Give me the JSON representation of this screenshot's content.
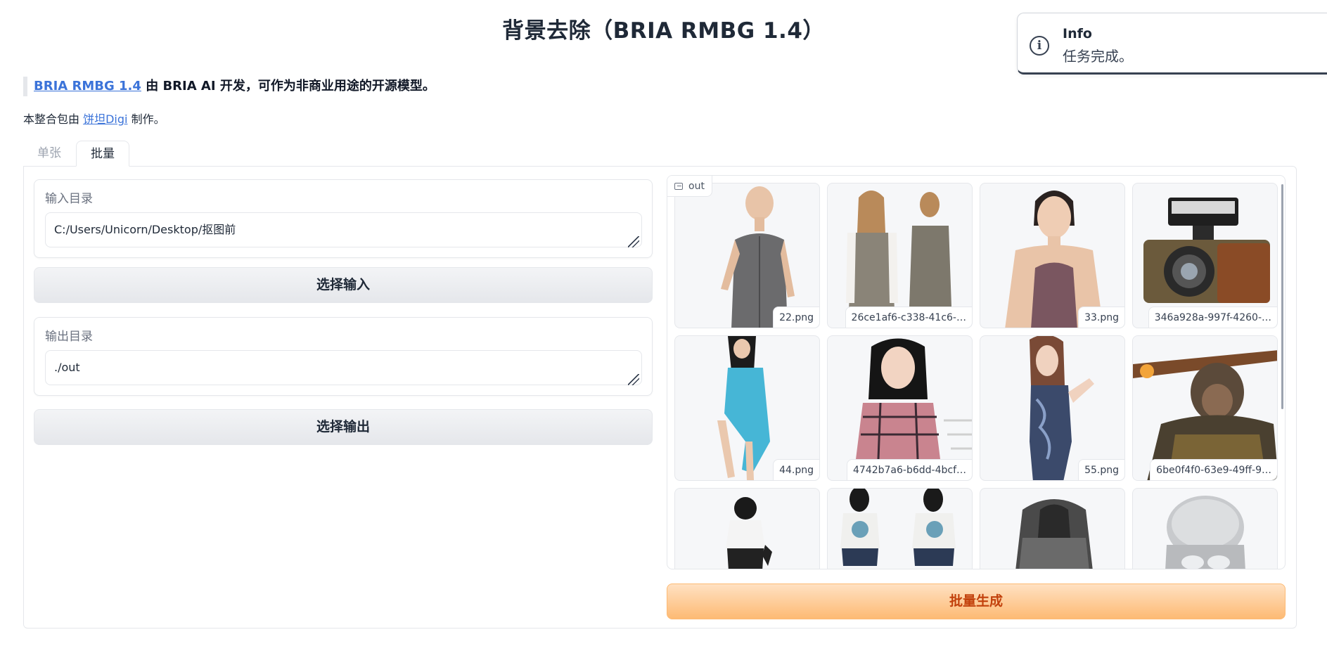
{
  "title": "背景去除（BRIA RMBG 1.4）",
  "toast": {
    "title": "Info",
    "message": "任务完成。",
    "icon": "info-icon"
  },
  "description": {
    "link_text": "BRIA RMBG 1.4",
    "text": "由 BRIA AI 开发，可作为非商业用途的开源模型。"
  },
  "credit": {
    "prefix": "本整合包由",
    "link_text": "饼坦Digi",
    "suffix": "制作。"
  },
  "tabs": [
    {
      "label": "单张",
      "active": false
    },
    {
      "label": "批量",
      "active": true
    }
  ],
  "input_dir": {
    "label": "输入目录",
    "value": "C:/Users/Unicorn/Desktop/抠图前"
  },
  "select_input_label": "选择输入",
  "output_dir": {
    "label": "输出目录",
    "value": "./out"
  },
  "select_output_label": "选择输出",
  "gallery": {
    "label": "out",
    "items": [
      {
        "caption": "22.png"
      },
      {
        "caption": "26ce1af6-c338-41c6-…"
      },
      {
        "caption": "33.png"
      },
      {
        "caption": "346a928a-997f-4260-…"
      },
      {
        "caption": "44.png"
      },
      {
        "caption": "4742b7a6-b6dd-4bcf…"
      },
      {
        "caption": "55.png"
      },
      {
        "caption": "6be0f4f0-63e9-49ff-9…"
      },
      {
        "caption": ""
      },
      {
        "caption": ""
      },
      {
        "caption": ""
      },
      {
        "caption": ""
      }
    ]
  },
  "generate_label": "批量生成",
  "colors": {
    "accent": "#fdba74",
    "accent_text": "#c2410c",
    "link": "#3b73d9"
  }
}
